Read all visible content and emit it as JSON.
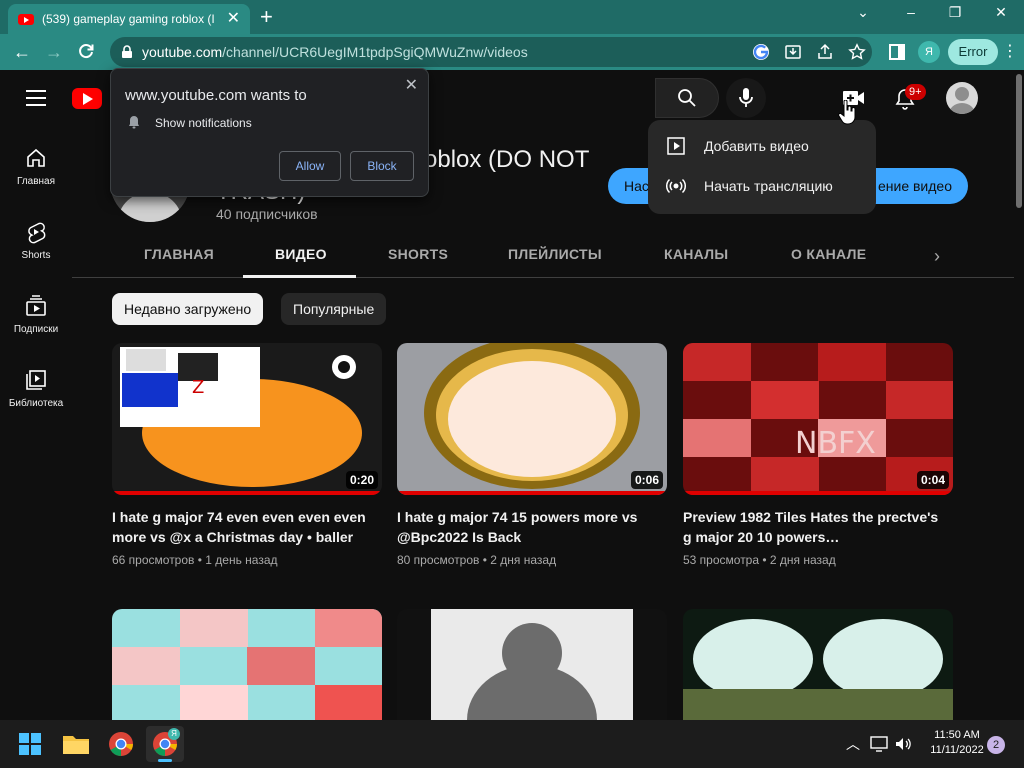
{
  "browser": {
    "tab_title": "(539) gameplay gaming roblox (I",
    "tab_close": "✕",
    "new_tab": "+",
    "window_controls": {
      "minimize": "–",
      "maximize": "❐",
      "close": "✕"
    },
    "url_host": "youtube.com",
    "url_path": "/channel/UCR6UegIM1tpdpSgiQMWuZnw/videos",
    "profile_initial": "Я",
    "error_label": "Error"
  },
  "youtube": {
    "notification_count": "9+",
    "sidebar": [
      {
        "label": "Главная",
        "icon": "home-icon"
      },
      {
        "label": "Shorts",
        "icon": "shorts-icon"
      },
      {
        "label": "Подписки",
        "icon": "subscriptions-icon"
      },
      {
        "label": "Библиотека",
        "icon": "library-icon"
      }
    ],
    "channel": {
      "name_visible": "oblox (DO NOT",
      "name_line2": "TRASH)",
      "subscribers": "40 подписчиков",
      "customize_left": "Нас",
      "customize_right": "ение видео"
    },
    "tabs": [
      {
        "label": "ГЛАВНАЯ",
        "active": false
      },
      {
        "label": "ВИДЕО",
        "active": true
      },
      {
        "label": "SHORTS",
        "active": false
      },
      {
        "label": "ПЛЕЙЛИСТЫ",
        "active": false
      },
      {
        "label": "КАНАЛЫ",
        "active": false
      },
      {
        "label": "О КАНАЛЕ",
        "active": false
      }
    ],
    "chips": {
      "recent": "Недавно загружено",
      "popular": "Популярные"
    },
    "videos": [
      {
        "title": "I hate g major 74 even even even even more vs @x a Christmas day • baller",
        "duration": "0:20",
        "meta": "66 просмотров • 1 день назад"
      },
      {
        "title": "I hate g major 74 15 powers more vs @Bpc2022 Is Back",
        "duration": "0:06",
        "meta": "80 просмотров • 2 дня назад"
      },
      {
        "title": "Preview 1982 Tiles Hates the prectve's g major 20 10 powers…",
        "duration": "0:04",
        "meta": "53 просмотра • 2 дня назад"
      }
    ],
    "create_menu": {
      "upload": "Добавить видео",
      "live": "Начать трансляцию"
    }
  },
  "permission_prompt": {
    "title": "www.youtube.com wants to",
    "permission": "Show notifications",
    "allow": "Allow",
    "block": "Block",
    "close": "✕"
  },
  "taskbar": {
    "time": "11:50 AM",
    "date": "11/11/2022",
    "notification_count": "2"
  }
}
